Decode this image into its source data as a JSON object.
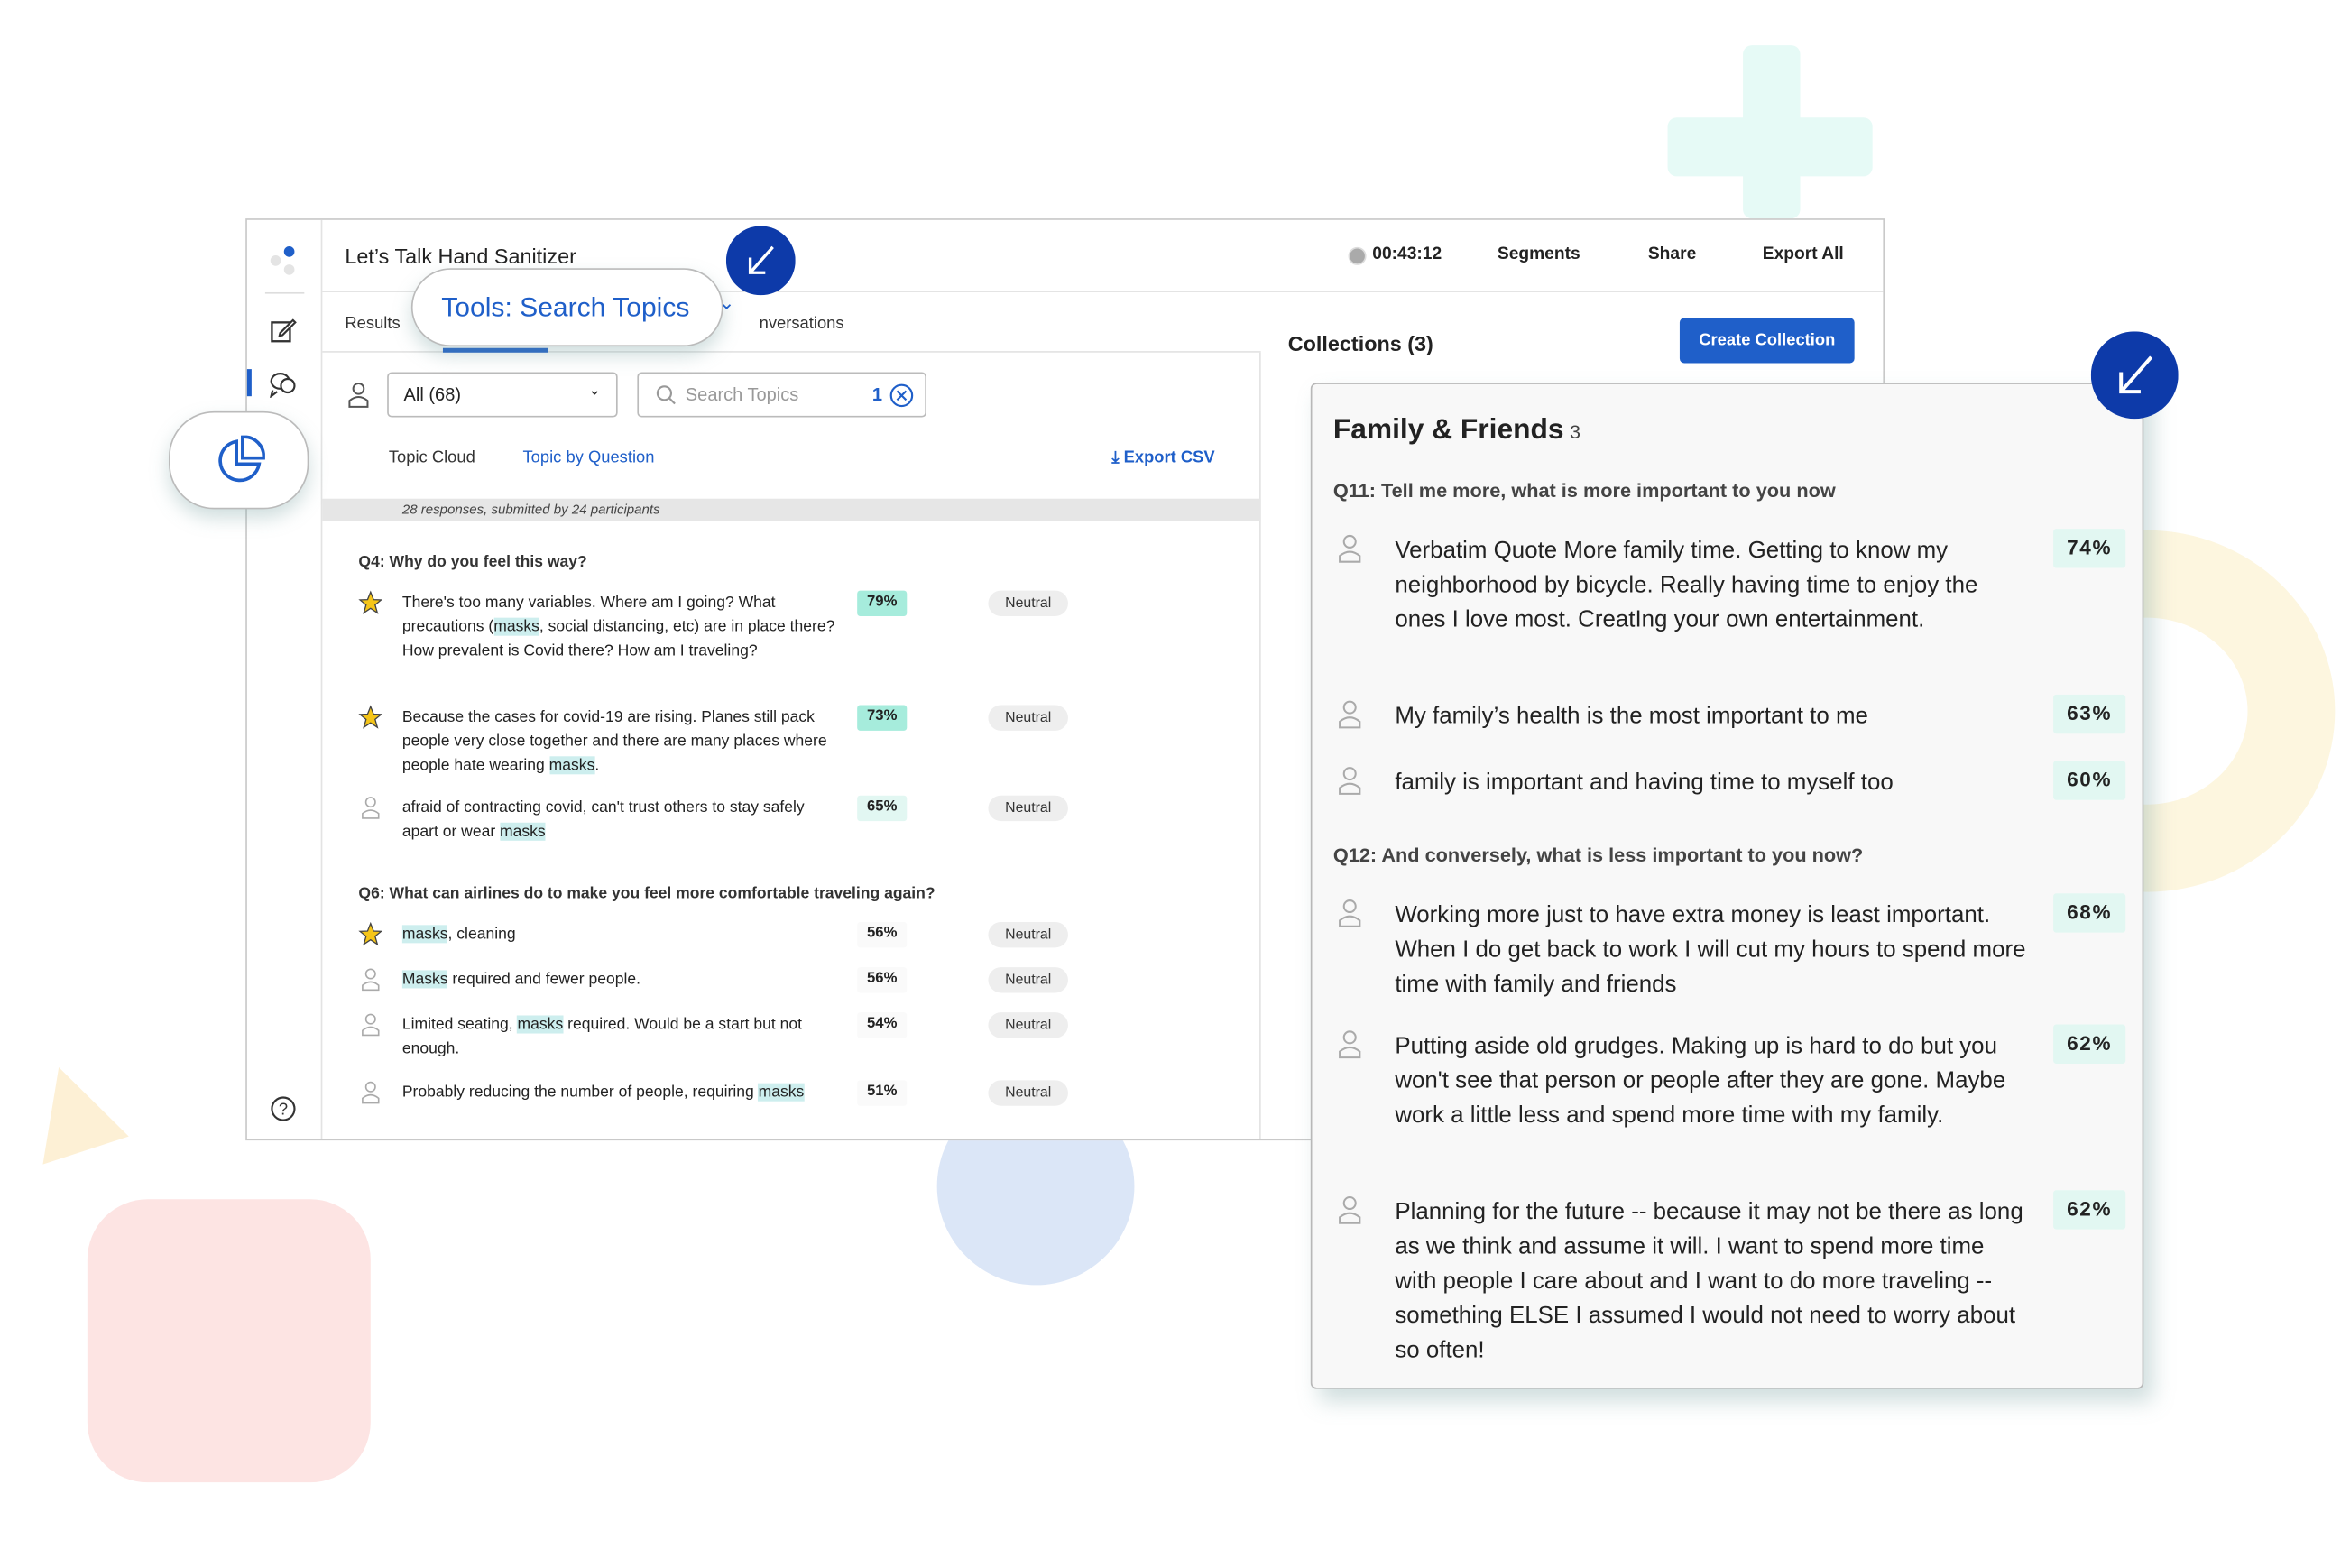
{
  "colors": {
    "accent": "#1f5fc9",
    "dark_accent": "#0d3aa9",
    "highlight": "#cdeeee",
    "high_score": "#a6ecdc",
    "low_score": "#e2f7f2"
  },
  "header": {
    "title": "Let’s Talk Hand Sanitizer",
    "timer": "00:43:12",
    "segments": "Segments",
    "share": "Share",
    "export_all": "Export All"
  },
  "tabs": {
    "results": "Results",
    "conversations": "nversations",
    "tools_pill": "Tools: Search Topics"
  },
  "filters": {
    "select_value": "All (68)",
    "search_placeholder": "Search Topics",
    "search_count": "1"
  },
  "subtabs": {
    "topic_cloud": "Topic Cloud",
    "topic_by_question": "Topic by Question",
    "export_csv": "Export CSV"
  },
  "banner": "28 responses, submitted by 24 participants",
  "questions": [
    {
      "title": "Q4: Why do you feel this way?",
      "rows": [
        {
          "icon": "star-icon",
          "parts": [
            "There's too many variables. Where am I going? What precautions (",
            "masks",
            ", social distancing, etc) are in place there? How prevalent is Covid there? How am I traveling?"
          ],
          "pct": "79%",
          "sentiment": "Neutral"
        },
        {
          "icon": "star-icon",
          "parts": [
            "Because the cases for covid-19 are rising. Planes still pack people very close together and there are many places where people hate wearing ",
            "masks",
            "."
          ],
          "pct": "73%",
          "sentiment": "Neutral"
        },
        {
          "icon": "user-icon",
          "parts": [
            "afraid of contracting covid, can't trust others to stay safely apart or wear ",
            "masks",
            ""
          ],
          "pct": "65%",
          "sentiment": "Neutral"
        }
      ]
    },
    {
      "title": "Q6: What can airlines do to make you feel more comfortable traveling again?",
      "rows": [
        {
          "icon": "star-icon",
          "parts": [
            "",
            "masks",
            ", cleaning"
          ],
          "pct": "56%",
          "sentiment": "Neutral"
        },
        {
          "icon": "user-icon",
          "parts": [
            "",
            "Masks",
            " required and fewer people."
          ],
          "pct": "56%",
          "sentiment": "Neutral"
        },
        {
          "icon": "user-icon",
          "parts": [
            "Limited seating, ",
            "masks",
            " required. Would be a start but not enough."
          ],
          "pct": "54%",
          "sentiment": "Neutral"
        },
        {
          "icon": "user-icon",
          "parts": [
            "Probably reducing the number of people, requiring ",
            "masks",
            ""
          ],
          "pct": "51%",
          "sentiment": "Neutral"
        }
      ]
    }
  ],
  "collections": {
    "title": "Collections (3)",
    "create": "Create Collection"
  },
  "card": {
    "title": "Family & Friends",
    "count": "3",
    "groups": [
      {
        "question": "Q11: Tell me more, what is more important to you now",
        "rows": [
          {
            "text": "Verbatim Quote More family time. Getting to know my neighborhood by bicycle. Really having time to enjoy the ones I love most. CreatIng your own entertainment.",
            "pct": "74%"
          },
          {
            "text": "My family’s health is the  most important to me",
            "pct": "63%"
          },
          {
            "text": "family is important and having time to myself too",
            "pct": "60%"
          }
        ]
      },
      {
        "question": "Q12: And conversely, what is less important to you now?",
        "rows": [
          {
            "text": "Working more just to have extra money is least important. When I do get back to work I will cut my hours to spend more time with family and friends",
            "pct": "68%"
          },
          {
            "text": "Putting aside old grudges. Making up is hard to do but you won't see that person or people after they are gone. Maybe work a little less and spend more time with my family.",
            "pct": "62%"
          },
          {
            "text": "Planning for the future -- because it may not be there as long as we think and assume it will. I want to spend more time with people I care about and I want to do more traveling -- something ELSE I assumed I would not need to worry about so often!",
            "pct": "62%"
          }
        ]
      }
    ]
  }
}
